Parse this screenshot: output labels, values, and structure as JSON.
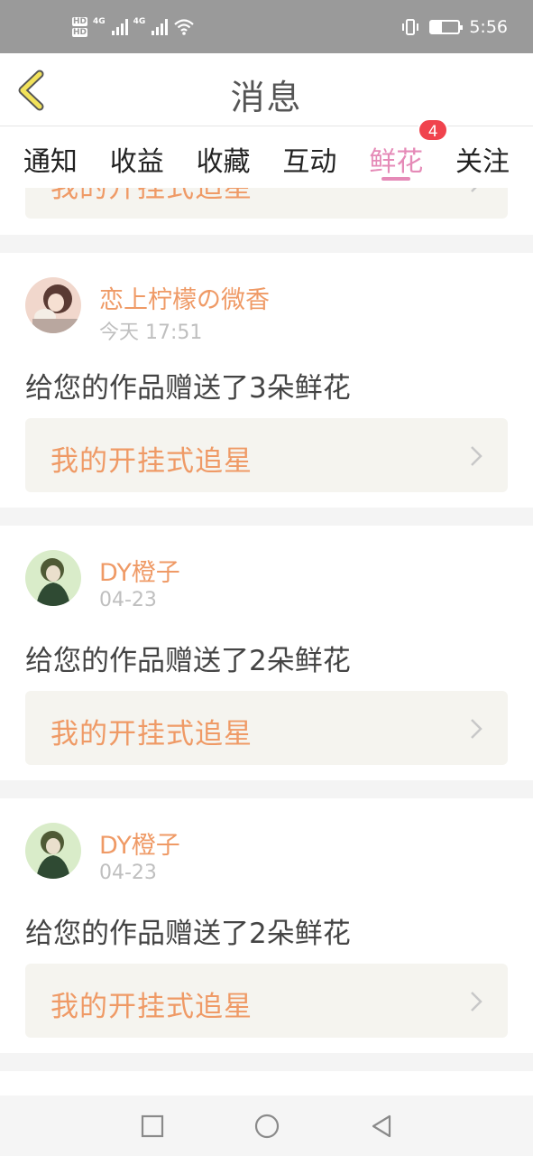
{
  "status_bar": {
    "hd1": "HD",
    "hd2": "HD",
    "net1": "4G",
    "net2": "4G",
    "time": "5:56",
    "battery_level": 0.4
  },
  "header": {
    "title": "消息",
    "back_icon": "chevron-left-icon"
  },
  "tabs": [
    {
      "label": "通知"
    },
    {
      "label": "收益"
    },
    {
      "label": "收藏"
    },
    {
      "label": "互动"
    },
    {
      "label": "鲜花",
      "badge": "4",
      "active": true
    },
    {
      "label": "关注"
    }
  ],
  "partial_item": {
    "link_label": "我的开挂式追星"
  },
  "items": [
    {
      "username": "恋上柠檬の微香",
      "time": "今天 17:51",
      "message": "给您的作品赠送了3朵鲜花",
      "link_label": "我的开挂式追星"
    },
    {
      "username": "DY橙子",
      "time": "04-23",
      "message": "给您的作品赠送了2朵鲜花",
      "link_label": "我的开挂式追星"
    },
    {
      "username": "DY橙子",
      "time": "04-23",
      "message": "给您的作品赠送了2朵鲜花",
      "link_label": "我的开挂式追星"
    }
  ],
  "colors": {
    "accent_pink": "#e58ab7",
    "username_orange": "#ef9a66",
    "badge_red": "#f0434d",
    "back_icon_yellow": "#f2e25a"
  },
  "nav_bar": {
    "icons": [
      "square-icon",
      "circle-icon",
      "triangle-back-icon"
    ]
  }
}
